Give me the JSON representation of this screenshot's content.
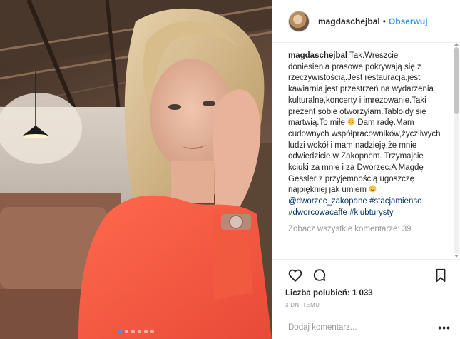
{
  "post": {
    "username": "magdaschejbal",
    "follow_separator": "•",
    "follow_label": "Obserwuj",
    "caption_username": "magdaschejbal",
    "caption_lines": [
      "Tak.Wreszcie doniesienia prasowe pokrywają się z rzeczywistością.Jest restauracja,jest kawiarnia,jest przestrzeń na wydarzenia kulturalne,koncerty i imrezowanie.Taki prezent sobie otworzyłam.Tabloidy się martwią.To miłe",
      " Dam radę.Mam cudownych współpracowników,życzliwych ludzi wokół i mam nadzieję,że mnie odwiedzicie w Zakopnem. Trzymajcie kciuki za mnie i za Dworzec.A Magdę Gessler z przyjemnością ugoszczę najpiękniej jak umiem"
    ],
    "hashtags": [
      "@dworzec_zakopane",
      "#stacjamienso",
      "#dworcowacaffe",
      "#klubturysty"
    ],
    "view_all_comments": "Zobacz wszystkie komentarze: 39",
    "likes_label": "Liczba polubień: 1 033",
    "time_ago": "3 DNI TEMU",
    "comment_placeholder": "Dodaj komentarz...",
    "more_label": "•••"
  },
  "icons": {
    "like": "heart-icon",
    "comment": "comment-bubble-icon",
    "save": "bookmark-icon",
    "emoji": "smiley-emoji-icon"
  },
  "carousel": {
    "dot_count": 6,
    "active_index": 0
  },
  "colors": {
    "link_blue": "#3897f0",
    "hashtag": "#003569",
    "muted": "#999999",
    "text": "#262626",
    "border": "#efefef"
  }
}
